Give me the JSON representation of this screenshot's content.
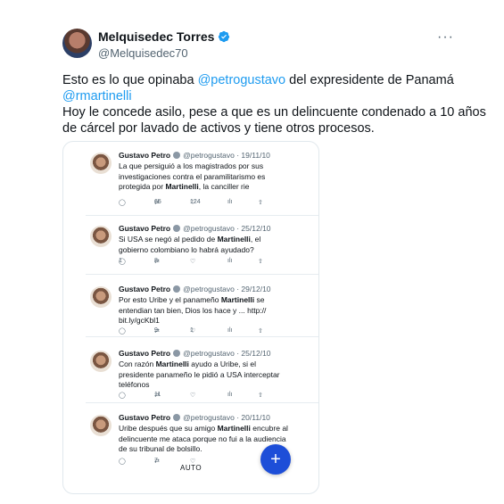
{
  "tweet": {
    "author": "Melquisedec Torres",
    "handle": "@Melquisedec70",
    "more": "···",
    "line1_pre": "Esto es lo que opinaba ",
    "line1_mention": "@petrogustavo",
    "line1_post": " del expresidente de Panamá",
    "line2_mention": "@rmartinelli",
    "line3": "Hoy le concede asilo, pese a que es un delincuente condenado a 10 años",
    "line4": "de cárcel por lavado de activos y tiene otros procesos."
  },
  "quoted": [
    {
      "name": "Gustavo Petro",
      "handle": "@petrogustavo · 19/11/10",
      "pre": "La que persiguió a los magistrados por sus investigaciones contra el paramilitarismo es protegida por ",
      "bold": "Martinelli",
      "post": ", la canciller rie",
      "retweets": "65",
      "likes": "124",
      "replies": ""
    },
    {
      "name": "Gustavo Petro",
      "handle": "@petrogustavo · 25/12/10",
      "pre": "Si USA se negó al pedido de ",
      "bold": "Martinelli",
      "post": ", el gobierno colombiano lo habrá ayudado?",
      "replies": "1",
      "retweets": "8",
      "likes": ""
    },
    {
      "name": "Gustavo Petro",
      "handle": "@petrogustavo · 29/12/10",
      "pre": "Por esto Uribe y el panameño ",
      "bold": "Martinelli",
      "post": " se entendian tan bien, Dios los hace y ... http:// bit.ly/gcKbl1",
      "replies": "",
      "retweets": "9",
      "likes": "1"
    },
    {
      "name": "Gustavo Petro",
      "handle": "@petrogustavo · 25/12/10",
      "pre": "Con razón ",
      "bold": "Martinelli",
      "post": " ayudo a Uribe, si el presidente panameño le pidió a USA interceptar teléfonos",
      "replies": "",
      "retweets": "11",
      "likes": ""
    },
    {
      "name": "Gustavo Petro",
      "handle": "@petrogustavo · 20/11/10",
      "pre": "Uribe después que su amigo ",
      "bold": "Martinelli",
      "post": " encubre al delincuente me ataca porque no fui a la audiencia de su tribunal de bolsillo.",
      "replies": "",
      "retweets": "7",
      "likes": ""
    }
  ],
  "fab": "+",
  "auto_label": "AUTO",
  "colors": {
    "accent": "#1d9bf0",
    "fab": "#1d4ed8",
    "muted": "#536471"
  }
}
